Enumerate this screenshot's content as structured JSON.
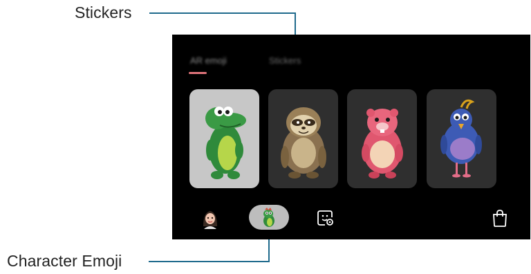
{
  "callouts": {
    "stickers": "Stickers",
    "character_emoji": "Character Emoji"
  },
  "tabs": [
    {
      "label": "AR emoji",
      "state": "selected"
    },
    {
      "label": "Stickers",
      "state": "unselected"
    }
  ],
  "characters": [
    {
      "name": "green dinosaur",
      "state": "selected"
    },
    {
      "name": "sloth"
    },
    {
      "name": "pink beaver"
    },
    {
      "name": "blue bird"
    }
  ],
  "bottom_bar": {
    "buttons": [
      {
        "icon": "my-emoji-avatar-icon"
      },
      {
        "icon": "character-emoji-icon",
        "state": "selected"
      },
      {
        "icon": "sticker-settings-icon"
      },
      {
        "icon": "store-bag-icon"
      }
    ]
  },
  "colors": {
    "accent": "#e0747b",
    "callout_line": "#1f6a8c",
    "selected_card": "#c7c7c7",
    "card": "#2f2f2f"
  }
}
